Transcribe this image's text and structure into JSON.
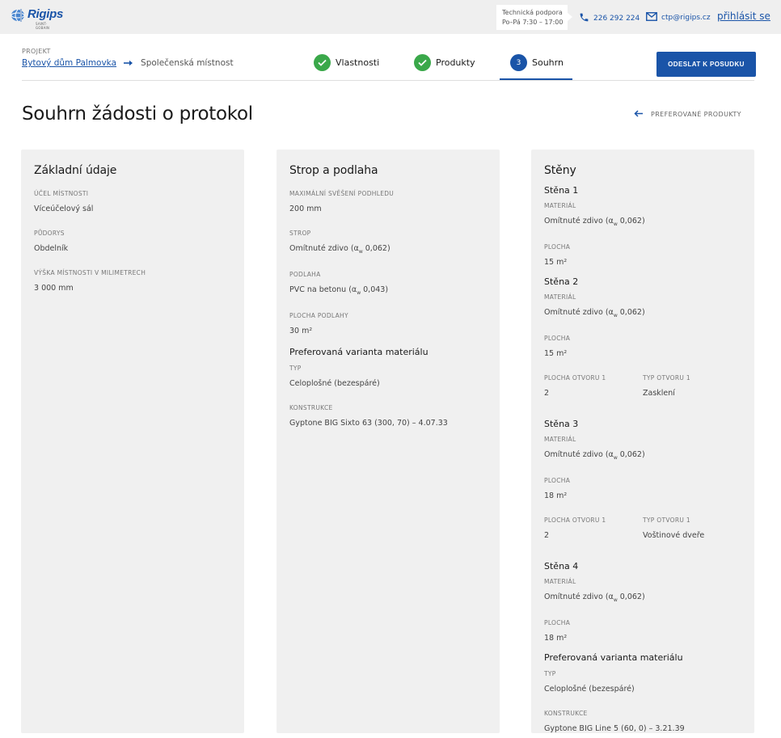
{
  "brand": {
    "name": "Rigips",
    "sub": "SAINT-GOBAIN",
    "color": "#1a54a8"
  },
  "support": {
    "line1": "Technická podpora",
    "line2": "Po–Pá 7:30 – 17:00"
  },
  "contact": {
    "phone": "226 292 224",
    "email": "ctp@rigips.cz",
    "login": "přihlásit se"
  },
  "project": {
    "label": "PROJEKT",
    "name": "Bytový dům Palmovka",
    "room": "Společenská místnost"
  },
  "steps": [
    {
      "label": "Vlastnosti",
      "state": "done"
    },
    {
      "label": "Produkty",
      "state": "done"
    },
    {
      "label": "Souhrn",
      "state": "active",
      "number": "3"
    }
  ],
  "send_button": "ODESLAT K POSUDKU",
  "page_title": "Souhrn žádosti o protokol",
  "back_link": "PREFEROVANÉ PRODUKTY",
  "basic": {
    "title": "Základní údaje",
    "purpose_label": "ÚČEL MÍSTNOSTI",
    "purpose": "Víceúčelový sál",
    "plan_label": "PŮDORYS",
    "plan": "Obdelník",
    "height_label": "VÝŠKA MÍSTNOSTI V MILIMETRECH",
    "height": "3 000 mm"
  },
  "ceiling": {
    "title": "Strop a podlaha",
    "drop_label": "MAXIMÁLNÍ SVĚŠENÍ PODHLEDU",
    "drop": "200 mm",
    "ceiling_label": "STROP",
    "ceiling": "Omítnuté zdivo (α",
    "ceiling_coef": "0,062)",
    "floor_label": "PODLAHA",
    "floor": "PVC na betonu (α",
    "floor_coef": "0,043)",
    "floor_area_label": "PLOCHA PODLAHY",
    "floor_area": "30 m²",
    "pref_title": "Preferovaná varianta materiálu",
    "type_label": "TYP",
    "type": "Celoplošné (bezespáré)",
    "construction_label": "KONSTRUKCE",
    "construction": "Gyptone BIG Sixto 63 (300, 70) – 4.07.33"
  },
  "walls": {
    "title": "Stěny",
    "material_label": "MATERIÁL",
    "area_label": "PLOCHA",
    "opening_area_label": "PLOCHA OTVORU 1",
    "opening_type_label": "TYP OTVORU 1",
    "material": "Omítnuté zdivo (α",
    "material_coef": "0,062)",
    "w_sub": "w",
    "items": [
      {
        "name": "Stěna 1",
        "area": "15 m²"
      },
      {
        "name": "Stěna 2",
        "area": "15 m²",
        "opening_area": "2",
        "opening_type": "Zasklení"
      },
      {
        "name": "Stěna 3",
        "area": "18 m²",
        "opening_area": "2",
        "opening_type": "Voštinové dveře"
      },
      {
        "name": "Stěna 4",
        "area": "18 m²"
      }
    ],
    "pref_title": "Preferovaná varianta materiálu",
    "type_label": "TYP",
    "type": "Celoplošné (bezespáré)",
    "construction_label": "KONSTRUKCE",
    "construction": "Gyptone BIG Line 5 (60, 0) – 3.21.39"
  }
}
